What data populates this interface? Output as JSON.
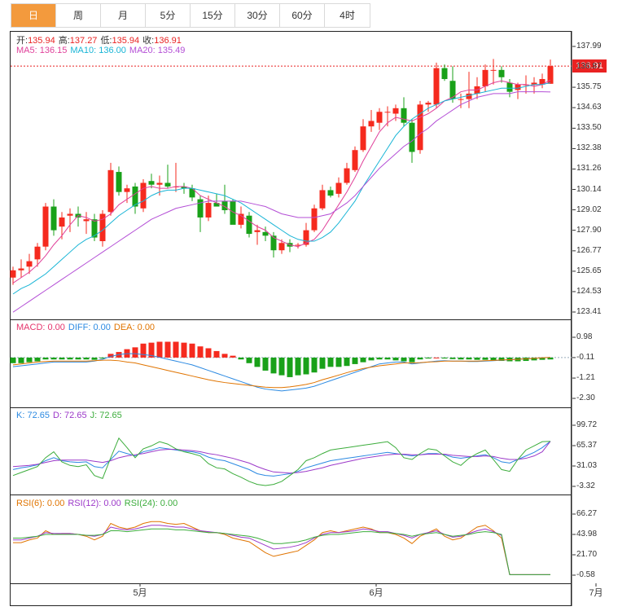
{
  "tabs": [
    "日",
    "周",
    "月",
    "5分",
    "15分",
    "30分",
    "60分",
    "4时"
  ],
  "active_tab": 0,
  "info": {
    "ohlc": [
      {
        "label": "开:",
        "value": "135.94"
      },
      {
        "label": "高:",
        "value": "137.27"
      },
      {
        "label": "低:",
        "value": "135.94"
      },
      {
        "label": "收:",
        "value": "136.91"
      }
    ],
    "ma": [
      {
        "label": "MA5: ",
        "value": "136.15",
        "color": "#e0409a"
      },
      {
        "label": "MA10: ",
        "value": "136.00",
        "color": "#19b5d6"
      },
      {
        "label": "MA20: ",
        "value": "135.49",
        "color": "#b44fd6"
      }
    ],
    "macd": [
      {
        "label": "MACD: ",
        "value": "0.00",
        "color": "#e5336b"
      },
      {
        "label": "DIFF: ",
        "value": "0.00",
        "color": "#2c8ae2"
      },
      {
        "label": "DEA: ",
        "value": "0.00",
        "color": "#e07400"
      }
    ],
    "kdj": [
      {
        "label": "K: ",
        "value": "72.65",
        "color": "#2c8ae2"
      },
      {
        "label": "D: ",
        "value": "72.65",
        "color": "#9c39c9"
      },
      {
        "label": "J: ",
        "value": "72.65",
        "color": "#3cad3c"
      }
    ],
    "rsi": [
      {
        "label": "RSI(6): ",
        "value": "0.00",
        "color": "#e07400"
      },
      {
        "label": "RSI(12): ",
        "value": "0.00",
        "color": "#9c39c9"
      },
      {
        "label": "RSI(24): ",
        "value": "0.00",
        "color": "#3cad3c"
      }
    ]
  },
  "last_price": "136.91",
  "colors": {
    "up": "#f52a1e",
    "down": "#19a119",
    "accent": "#f39a3d"
  },
  "chart_data": {
    "type": "candlestick",
    "price_axis": {
      "ticks": [
        "137.99",
        "136.87",
        "135.75",
        "134.63",
        "133.50",
        "132.38",
        "131.26",
        "130.14",
        "129.02",
        "127.90",
        "126.77",
        "125.65",
        "124.53",
        "123.41"
      ],
      "range": [
        123.41,
        137.99
      ]
    },
    "macd_axis": {
      "ticks": [
        "0.98",
        "-0.11",
        "-1.21",
        "-2.30"
      ],
      "range": [
        -2.3,
        0.98
      ]
    },
    "kdj_axis": {
      "ticks": [
        "99.72",
        "65.37",
        "31.03",
        "-3.32"
      ],
      "range": [
        -3.32,
        99.72
      ]
    },
    "rsi_axis": {
      "ticks": [
        "66.27",
        "43.98",
        "21.70",
        "-0.58"
      ],
      "range": [
        -0.58,
        66.27
      ]
    },
    "x_labels": [
      {
        "label": "5月",
        "index": 17
      },
      {
        "label": "6月",
        "index": 46
      },
      {
        "label": "7月",
        "index": 73
      }
    ],
    "candles": [
      [
        125.3,
        125.9,
        124.9,
        125.7
      ],
      [
        125.7,
        126.3,
        125.3,
        125.8
      ],
      [
        125.9,
        126.6,
        125.5,
        126.2
      ],
      [
        126.3,
        127.2,
        125.9,
        127.0
      ],
      [
        127.0,
        129.4,
        126.8,
        129.2
      ],
      [
        129.2,
        129.6,
        127.6,
        127.9
      ],
      [
        128.1,
        128.9,
        127.4,
        128.6
      ],
      [
        128.7,
        129.1,
        127.8,
        128.8
      ],
      [
        128.8,
        129.2,
        128.1,
        128.6
      ],
      [
        128.4,
        128.9,
        127.7,
        128.5
      ],
      [
        128.5,
        128.8,
        127.3,
        127.5
      ],
      [
        127.3,
        129.0,
        127.0,
        128.8
      ],
      [
        128.9,
        131.6,
        128.7,
        131.2
      ],
      [
        131.1,
        131.4,
        129.8,
        130.0
      ],
      [
        130.0,
        130.4,
        129.4,
        130.2
      ],
      [
        130.3,
        130.5,
        128.8,
        129.2
      ],
      [
        129.1,
        130.7,
        128.9,
        130.5
      ],
      [
        130.6,
        131.0,
        130.2,
        130.4
      ],
      [
        130.4,
        130.9,
        129.8,
        130.5
      ],
      [
        130.5,
        131.5,
        130.2,
        130.3
      ],
      [
        130.3,
        131.6,
        130.0,
        130.3
      ],
      [
        130.3,
        130.5,
        129.9,
        130.2
      ],
      [
        130.2,
        130.4,
        129.5,
        129.7
      ],
      [
        129.6,
        129.8,
        127.8,
        128.6
      ],
      [
        128.6,
        129.8,
        128.4,
        129.4
      ],
      [
        129.4,
        129.9,
        129.2,
        129.2
      ],
      [
        129.5,
        130.4,
        128.8,
        129.0
      ],
      [
        129.5,
        129.6,
        128.9,
        128.2
      ],
      [
        128.2,
        129.2,
        128.0,
        128.8
      ],
      [
        128.7,
        128.9,
        127.5,
        127.7
      ],
      [
        127.8,
        128.2,
        127.1,
        127.9
      ],
      [
        127.8,
        128.1,
        127.3,
        127.6
      ],
      [
        127.6,
        127.8,
        126.4,
        126.8
      ],
      [
        126.8,
        127.4,
        126.6,
        127.2
      ],
      [
        127.2,
        127.4,
        126.7,
        127.0
      ],
      [
        127.1,
        127.2,
        126.9,
        127.1
      ],
      [
        127.1,
        128.3,
        127.0,
        127.9
      ],
      [
        127.9,
        129.3,
        127.8,
        129.1
      ],
      [
        129.1,
        130.4,
        129.0,
        130.1
      ],
      [
        130.1,
        130.3,
        129.7,
        129.8
      ],
      [
        129.9,
        130.8,
        129.7,
        130.5
      ],
      [
        130.5,
        131.6,
        130.4,
        131.3
      ],
      [
        131.2,
        132.5,
        131.1,
        132.3
      ],
      [
        132.3,
        134.0,
        132.2,
        133.6
      ],
      [
        133.6,
        134.5,
        133.3,
        133.9
      ],
      [
        133.8,
        134.6,
        133.4,
        134.4
      ],
      [
        134.4,
        134.7,
        133.6,
        134.4
      ],
      [
        134.3,
        134.8,
        133.9,
        134.6
      ],
      [
        134.6,
        135.2,
        133.6,
        133.8
      ],
      [
        133.8,
        134.0,
        131.6,
        132.2
      ],
      [
        132.3,
        135.0,
        132.1,
        134.8
      ],
      [
        134.8,
        135.0,
        134.4,
        134.9
      ],
      [
        134.8,
        137.1,
        134.6,
        136.8
      ],
      [
        136.8,
        137.0,
        136.1,
        136.2
      ],
      [
        136.1,
        136.9,
        134.9,
        135.1
      ],
      [
        135.1,
        135.4,
        134.6,
        135.1
      ],
      [
        135.1,
        136.6,
        134.6,
        135.4
      ],
      [
        135.4,
        136.3,
        135.1,
        135.8
      ],
      [
        135.8,
        137.0,
        135.5,
        136.7
      ],
      [
        136.7,
        137.3,
        135.9,
        136.7
      ],
      [
        136.7,
        136.9,
        136.0,
        136.3
      ],
      [
        136.0,
        136.2,
        135.2,
        135.5
      ],
      [
        135.6,
        136.0,
        135.1,
        135.9
      ],
      [
        135.9,
        136.4,
        135.4,
        135.9
      ],
      [
        135.9,
        136.3,
        135.4,
        136.0
      ],
      [
        135.9,
        136.5,
        135.7,
        136.2
      ],
      [
        135.94,
        137.27,
        135.94,
        136.91
      ]
    ],
    "ma5": [
      125.0,
      125.3,
      125.6,
      126.0,
      126.5,
      127.1,
      127.6,
      128.2,
      128.7,
      128.6,
      128.4,
      128.5,
      128.8,
      129.3,
      129.6,
      129.9,
      130.2,
      130.3,
      130.2,
      130.2,
      130.3,
      130.3,
      130.2,
      129.8,
      129.6,
      129.4,
      129.2,
      128.9,
      128.7,
      128.4,
      128.1,
      127.9,
      127.5,
      127.3,
      127.1,
      127.0,
      127.2,
      127.4,
      127.9,
      128.6,
      129.3,
      130.0,
      130.8,
      131.7,
      132.5,
      133.3,
      133.8,
      134.1,
      134.0,
      133.9,
      134.1,
      134.3,
      134.6,
      135.0,
      135.2,
      135.5,
      135.6,
      135.6,
      135.8,
      136.0,
      136.1,
      136.0,
      135.9,
      135.9,
      135.8,
      135.9,
      136.15
    ],
    "ma10": [
      124.4,
      124.7,
      124.9,
      125.2,
      125.5,
      125.9,
      126.3,
      126.7,
      127.1,
      127.4,
      127.6,
      127.9,
      128.3,
      128.7,
      129.0,
      129.3,
      129.5,
      129.8,
      130.0,
      130.1,
      130.1,
      130.2,
      130.2,
      130.1,
      130.0,
      129.9,
      129.8,
      129.6,
      129.4,
      129.1,
      128.8,
      128.5,
      128.2,
      127.9,
      127.6,
      127.4,
      127.3,
      127.3,
      127.5,
      127.8,
      128.3,
      128.9,
      129.5,
      130.3,
      131.0,
      131.7,
      132.4,
      133.1,
      133.6,
      134.0,
      134.3,
      134.6,
      134.8,
      135.0,
      135.1,
      135.2,
      135.3,
      135.4,
      135.5,
      135.6,
      135.7,
      135.7,
      135.7,
      135.8,
      135.9,
      135.9,
      136.0
    ],
    "ma20": [
      123.4,
      123.7,
      124.0,
      124.3,
      124.6,
      124.9,
      125.2,
      125.5,
      125.8,
      126.1,
      126.4,
      126.7,
      127.0,
      127.3,
      127.6,
      127.9,
      128.2,
      128.5,
      128.7,
      128.9,
      129.1,
      129.2,
      129.3,
      129.4,
      129.5,
      129.5,
      129.5,
      129.5,
      129.5,
      129.4,
      129.3,
      129.2,
      129.0,
      128.8,
      128.7,
      128.6,
      128.6,
      128.6,
      128.7,
      128.8,
      129.1,
      129.4,
      129.8,
      130.3,
      130.8,
      131.3,
      131.7,
      132.1,
      132.5,
      132.8,
      133.2,
      133.5,
      133.9,
      134.2,
      134.5,
      134.8,
      135.0,
      135.2,
      135.3,
      135.4,
      135.4,
      135.4,
      135.5,
      135.5,
      135.5,
      135.5,
      135.49
    ],
    "macd_hist": [
      -0.3,
      -0.3,
      -0.25,
      -0.2,
      -0.1,
      -0.1,
      -0.1,
      -0.1,
      -0.1,
      -0.1,
      -0.12,
      -0.05,
      0.2,
      0.3,
      0.45,
      0.55,
      0.75,
      0.8,
      0.85,
      0.85,
      0.85,
      0.8,
      0.75,
      0.6,
      0.5,
      0.35,
      0.2,
      0.1,
      -0.1,
      -0.3,
      -0.5,
      -0.7,
      -0.85,
      -0.95,
      -1.05,
      -0.95,
      -0.9,
      -0.8,
      -0.6,
      -0.5,
      -0.5,
      -0.45,
      -0.35,
      -0.25,
      -0.15,
      -0.1,
      -0.1,
      -0.15,
      -0.2,
      -0.25,
      -0.1,
      -0.05,
      0.0,
      -0.05,
      -0.08,
      -0.1,
      -0.1,
      -0.12,
      -0.12,
      -0.15,
      -0.18,
      -0.2,
      -0.2,
      -0.18,
      -0.15,
      -0.12,
      -0.1
    ],
    "diff": [
      -0.6,
      -0.55,
      -0.5,
      -0.45,
      -0.4,
      -0.35,
      -0.35,
      -0.35,
      -0.35,
      -0.35,
      -0.3,
      -0.2,
      -0.05,
      0.05,
      0.1,
      0.1,
      0.05,
      0.0,
      -0.1,
      -0.2,
      -0.3,
      -0.4,
      -0.5,
      -0.65,
      -0.8,
      -0.95,
      -1.1,
      -1.25,
      -1.4,
      -1.55,
      -1.7,
      -1.8,
      -1.85,
      -1.9,
      -1.85,
      -1.8,
      -1.75,
      -1.65,
      -1.5,
      -1.35,
      -1.2,
      -1.05,
      -0.9,
      -0.75,
      -0.6,
      -0.45,
      -0.4,
      -0.35,
      -0.35,
      -0.45,
      -0.4,
      -0.35,
      -0.3,
      -0.28,
      -0.3,
      -0.3,
      -0.32,
      -0.32,
      -0.3,
      -0.28,
      -0.25,
      -0.22,
      -0.2,
      -0.18,
      -0.15,
      -0.12,
      -0.1
    ],
    "dea": [
      -0.5,
      -0.45,
      -0.4,
      -0.35,
      -0.32,
      -0.3,
      -0.3,
      -0.3,
      -0.3,
      -0.3,
      -0.28,
      -0.25,
      -0.25,
      -0.28,
      -0.35,
      -0.4,
      -0.5,
      -0.6,
      -0.7,
      -0.8,
      -0.9,
      -1.0,
      -1.1,
      -1.2,
      -1.3,
      -1.38,
      -1.45,
      -1.5,
      -1.55,
      -1.6,
      -1.65,
      -1.7,
      -1.72,
      -1.72,
      -1.68,
      -1.62,
      -1.55,
      -1.45,
      -1.3,
      -1.18,
      -1.05,
      -0.92,
      -0.8,
      -0.7,
      -0.62,
      -0.55,
      -0.5,
      -0.45,
      -0.4,
      -0.4,
      -0.38,
      -0.35,
      -0.33,
      -0.3,
      -0.3,
      -0.3,
      -0.3,
      -0.3,
      -0.28,
      -0.26,
      -0.24,
      -0.22,
      -0.2,
      -0.18,
      -0.15,
      -0.12,
      -0.1
    ],
    "k": [
      25,
      28,
      30,
      33,
      40,
      45,
      40,
      38,
      37,
      38,
      30,
      28,
      42,
      56,
      52,
      48,
      55,
      58,
      62,
      60,
      58,
      56,
      55,
      52,
      46,
      42,
      40,
      35,
      30,
      25,
      18,
      15,
      14,
      16,
      18,
      22,
      28,
      32,
      36,
      40,
      42,
      44,
      46,
      48,
      50,
      52,
      54,
      52,
      50,
      48,
      50,
      52,
      52,
      50,
      46,
      44,
      46,
      48,
      50,
      45,
      38,
      36,
      42,
      48,
      54,
      62,
      72.65
    ],
    "d": [
      30,
      31,
      32,
      34,
      37,
      40,
      41,
      41,
      41,
      41,
      39,
      37,
      40,
      45,
      48,
      50,
      52,
      55,
      58,
      59,
      59,
      58,
      57,
      55,
      52,
      50,
      47,
      44,
      40,
      36,
      30,
      25,
      21,
      20,
      19,
      20,
      22,
      25,
      28,
      32,
      35,
      38,
      41,
      44,
      46,
      48,
      50,
      51,
      51,
      50,
      50,
      51,
      51,
      51,
      49,
      48,
      47,
      47,
      48,
      47,
      44,
      42,
      42,
      44,
      48,
      55,
      72.65
    ],
    "j": [
      15,
      20,
      25,
      30,
      45,
      55,
      38,
      32,
      30,
      33,
      15,
      10,
      45,
      78,
      62,
      45,
      60,
      65,
      72,
      68,
      60,
      55,
      52,
      48,
      35,
      28,
      26,
      18,
      12,
      5,
      0,
      -2,
      0,
      5,
      15,
      25,
      40,
      45,
      52,
      58,
      60,
      62,
      64,
      66,
      68,
      70,
      72,
      62,
      45,
      42,
      52,
      60,
      58,
      48,
      38,
      32,
      44,
      52,
      58,
      42,
      25,
      22,
      42,
      58,
      65,
      72,
      72.65
    ],
    "rsi6": [
      35,
      35,
      38,
      40,
      48,
      44,
      45,
      45,
      44,
      42,
      38,
      42,
      56,
      52,
      50,
      52,
      56,
      58,
      58,
      56,
      55,
      56,
      52,
      48,
      46,
      46,
      44,
      40,
      38,
      36,
      30,
      24,
      20,
      22,
      24,
      26,
      32,
      38,
      46,
      48,
      46,
      48,
      50,
      52,
      50,
      46,
      46,
      44,
      40,
      34,
      42,
      46,
      50,
      42,
      38,
      40,
      46,
      52,
      54,
      48,
      40,
      0,
      0,
      0,
      0,
      0,
      0
    ],
    "rsi12": [
      38,
      38,
      40,
      42,
      46,
      45,
      45,
      45,
      44,
      43,
      42,
      44,
      52,
      50,
      49,
      50,
      52,
      54,
      54,
      53,
      52,
      52,
      50,
      48,
      47,
      46,
      45,
      43,
      41,
      40,
      36,
      32,
      28,
      29,
      30,
      32,
      35,
      40,
      44,
      46,
      46,
      47,
      48,
      50,
      49,
      47,
      47,
      45,
      43,
      40,
      44,
      46,
      48,
      44,
      41,
      42,
      45,
      48,
      50,
      47,
      43,
      0,
      0,
      0,
      0,
      0,
      0
    ],
    "rsi24": [
      40,
      40,
      41,
      42,
      44,
      44,
      44,
      44,
      44,
      43,
      43,
      44,
      48,
      48,
      47,
      48,
      49,
      50,
      50,
      50,
      49,
      49,
      48,
      47,
      46,
      46,
      45,
      44,
      43,
      42,
      40,
      37,
      34,
      34,
      35,
      36,
      38,
      41,
      43,
      44,
      44,
      45,
      46,
      47,
      47,
      46,
      46,
      45,
      44,
      42,
      44,
      45,
      46,
      44,
      42,
      43,
      44,
      46,
      47,
      46,
      44,
      0,
      0,
      0,
      0,
      0,
      0
    ]
  }
}
